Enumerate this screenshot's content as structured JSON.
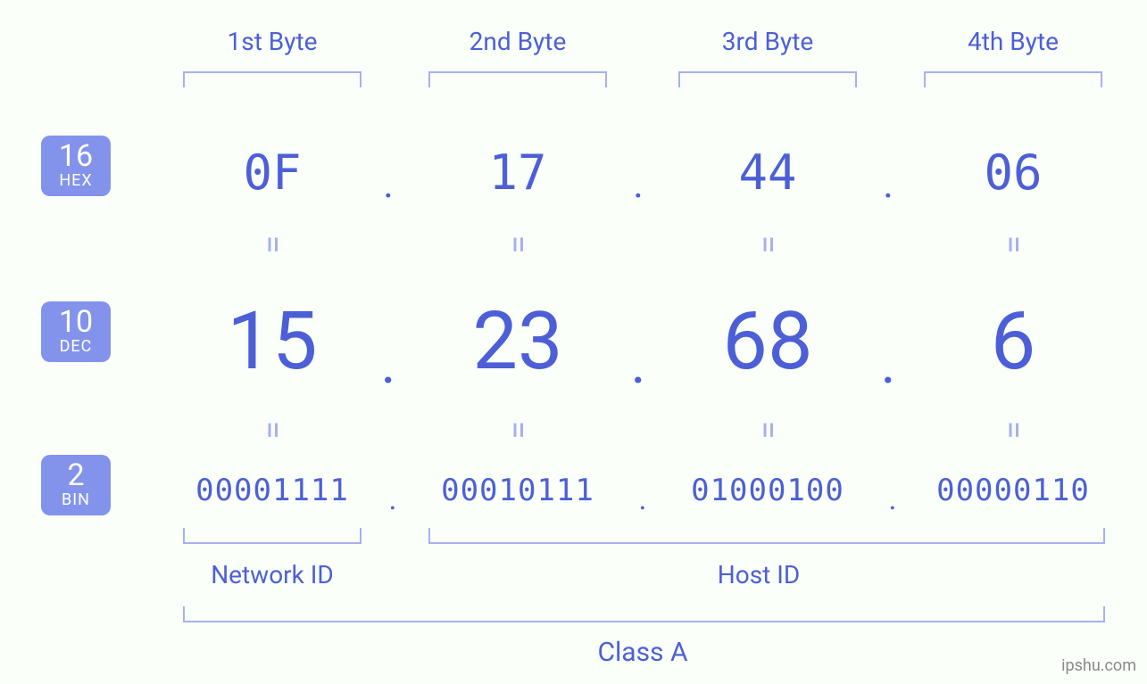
{
  "header": {
    "bytes": [
      "1st Byte",
      "2nd Byte",
      "3rd Byte",
      "4th Byte"
    ]
  },
  "bases": {
    "hex": {
      "num": "16",
      "label": "HEX"
    },
    "dec": {
      "num": "10",
      "label": "DEC"
    },
    "bin": {
      "num": "2",
      "label": "BIN"
    }
  },
  "equals_glyph": "=",
  "dot_glyph": ".",
  "ip": {
    "hex": [
      "0F",
      "17",
      "44",
      "06"
    ],
    "dec": [
      "15",
      "23",
      "68",
      "6"
    ],
    "bin": [
      "00001111",
      "00010111",
      "01000100",
      "00000110"
    ]
  },
  "footer": {
    "network_id": "Network ID",
    "host_id": "Host ID",
    "class": "Class A"
  },
  "watermark": "ipshu.com"
}
